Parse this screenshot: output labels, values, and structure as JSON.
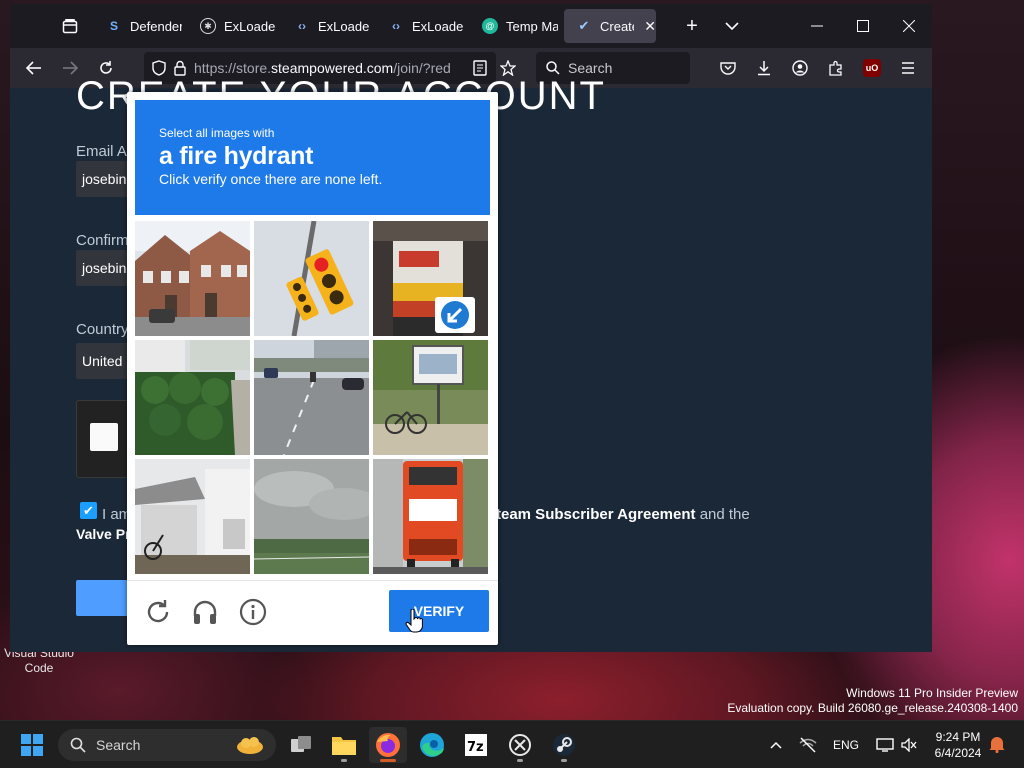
{
  "desktop": {
    "icon_label_line1": "Visual Studio",
    "icon_label_line2": "Code",
    "watermark_line1": "Windows 11 Pro Insider Preview",
    "watermark_line2": "Evaluation copy. Build 26080.ge_release.240308-1400"
  },
  "browser": {
    "tabs": [
      {
        "label": "Defender",
        "icon": "defender-icon"
      },
      {
        "label": "ExLoader |",
        "icon": "exloader-icon"
      },
      {
        "label": "ExLoader",
        "icon": "code-icon"
      },
      {
        "label": "ExLoader",
        "icon": "code-icon"
      },
      {
        "label": "Temp Ma",
        "icon": "temp-mail-icon"
      },
      {
        "label": "Create",
        "icon": "steam-icon"
      }
    ],
    "url_prefix": "https://store.",
    "url_host": "steampowered.com",
    "url_path": "/join/?red",
    "search_placeholder": "Search"
  },
  "page": {
    "heading": "CREATE YOUR ACCOUNT",
    "email_label": "Email Ac",
    "email_value": "josebin",
    "confirm_label": "Confirm",
    "confirm_value": "josebin",
    "country_label": "Country",
    "country_value": "United",
    "agree_start": "I am",
    "agree_link": "team Subscriber Agreement",
    "agree_end": "and the",
    "agree_line2": "Valve Pr"
  },
  "captcha": {
    "prompt_small": "Select all images with",
    "prompt_big": "a fire hydrant",
    "prompt_sub": "Click verify once there are none left.",
    "verify_label": "VERIFY",
    "tiles": [
      "houses",
      "traffic-light",
      "truck-sign",
      "hedge",
      "road",
      "bicycles-sign",
      "shed-bike",
      "cloudy-field",
      "bus"
    ]
  },
  "taskbar": {
    "search_label": "Search",
    "language": "ENG",
    "time": "9:24 PM",
    "date": "6/4/2024"
  },
  "colors": {
    "captcha_blue": "#1e7ae8",
    "steam_bg": "#1b2838",
    "firefox_tabbar": "#1c1b22"
  }
}
